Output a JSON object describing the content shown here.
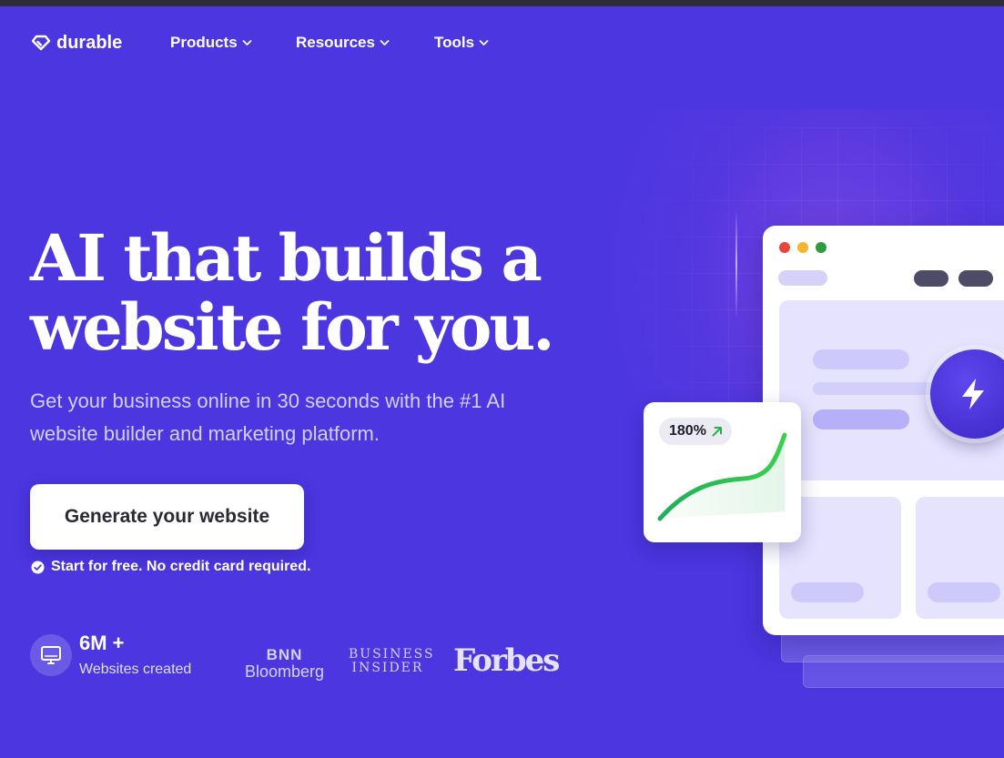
{
  "nav": {
    "logo_text": "durable",
    "items": [
      {
        "label": "Products"
      },
      {
        "label": "Resources"
      },
      {
        "label": "Tools"
      }
    ]
  },
  "hero": {
    "headline_line1": "AI that builds a",
    "headline_line2": "website for you.",
    "subtitle": "Get your business online in 30 seconds with the #1 AI website builder and marketing platform.",
    "cta_label": "Generate your website",
    "note": "Start for free. No credit card required."
  },
  "stats": {
    "value": "6M +",
    "label": "Websites created"
  },
  "press": {
    "bnn_line1": "BNN",
    "bnn_line2": "Bloomberg",
    "bi_line1": "BUSINESS",
    "bi_line2": "INSIDER",
    "forbes": "Forbes"
  },
  "mockup": {
    "growth_badge": "180%"
  },
  "colors": {
    "background": "#4b36e0",
    "accent_green": "#22b14c",
    "window_dot_red": "#e8453c",
    "window_dot_yellow": "#f5b52e",
    "window_dot_green": "#2f9a41"
  },
  "icons": {
    "logo": "diamond-logo-icon",
    "chevron": "chevron-down-icon",
    "check": "check-circle-icon",
    "monitor": "monitor-icon",
    "bolt": "lightning-bolt-icon",
    "arrow": "arrow-up-right-icon"
  }
}
